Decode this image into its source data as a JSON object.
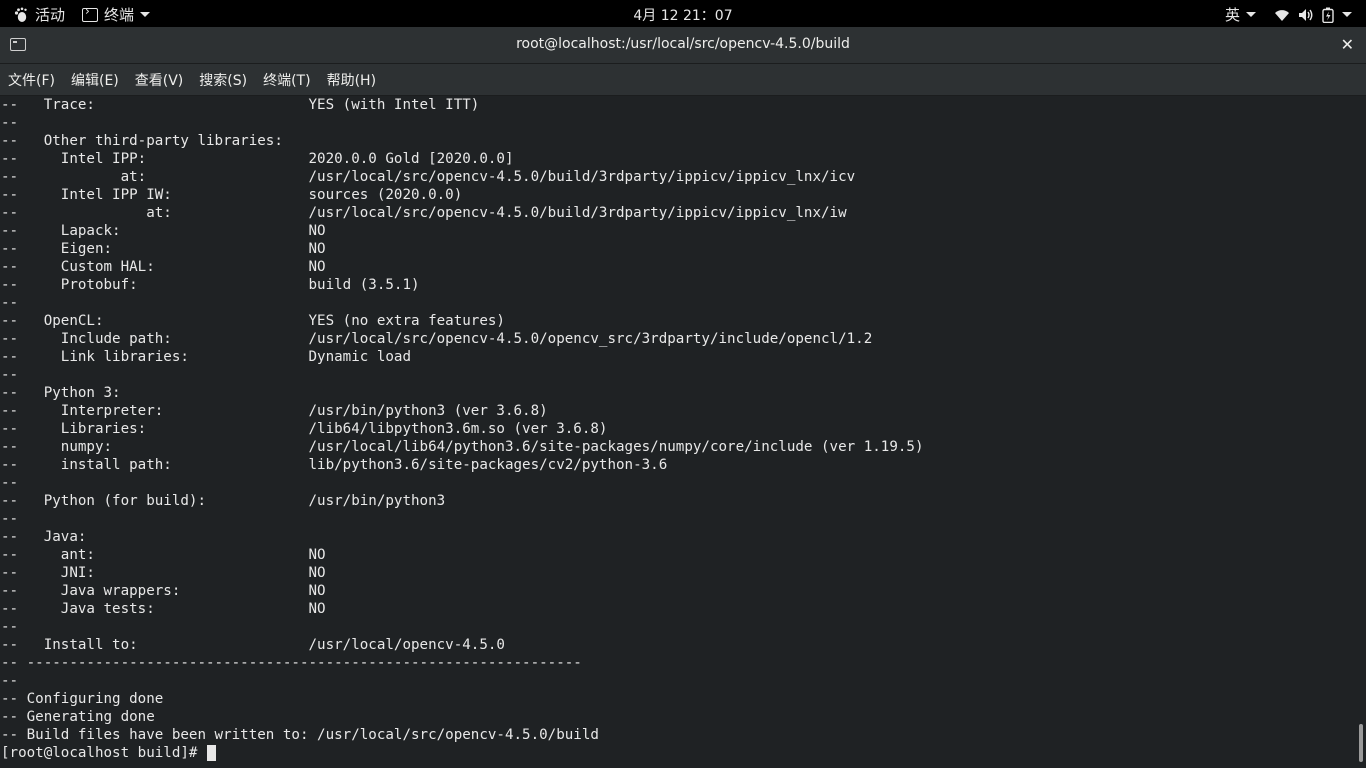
{
  "topbar": {
    "activities_label": "活动",
    "app_label": "终端",
    "clock": "4月 12 21：07",
    "input_method": "英"
  },
  "window": {
    "title": "root@localhost:/usr/local/src/opencv-4.5.0/build",
    "close_glyph": "✕"
  },
  "menu": {
    "items": [
      "文件(F)",
      "编辑(E)",
      "查看(V)",
      "搜索(S)",
      "终端(T)",
      "帮助(H)"
    ]
  },
  "terminal": {
    "lines": [
      "--   Trace:                         YES (with Intel ITT)",
      "--",
      "--   Other third-party libraries:",
      "--     Intel IPP:                   2020.0.0 Gold [2020.0.0]",
      "--            at:                   /usr/local/src/opencv-4.5.0/build/3rdparty/ippicv/ippicv_lnx/icv",
      "--     Intel IPP IW:                sources (2020.0.0)",
      "--               at:                /usr/local/src/opencv-4.5.0/build/3rdparty/ippicv/ippicv_lnx/iw",
      "--     Lapack:                      NO",
      "--     Eigen:                       NO",
      "--     Custom HAL:                  NO",
      "--     Protobuf:                    build (3.5.1)",
      "--",
      "--   OpenCL:                        YES (no extra features)",
      "--     Include path:                /usr/local/src/opencv-4.5.0/opencv_src/3rdparty/include/opencl/1.2",
      "--     Link libraries:              Dynamic load",
      "--",
      "--   Python 3:",
      "--     Interpreter:                 /usr/bin/python3 (ver 3.6.8)",
      "--     Libraries:                   /lib64/libpython3.6m.so (ver 3.6.8)",
      "--     numpy:                       /usr/local/lib64/python3.6/site-packages/numpy/core/include (ver 1.19.5)",
      "--     install path:                lib/python3.6/site-packages/cv2/python-3.6",
      "--",
      "--   Python (for build):            /usr/bin/python3",
      "--",
      "--   Java:",
      "--     ant:                         NO",
      "--     JNI:                         NO",
      "--     Java wrappers:               NO",
      "--     Java tests:                  NO",
      "--",
      "--   Install to:                    /usr/local/opencv-4.5.0",
      "-- -----------------------------------------------------------------",
      "--",
      "-- Configuring done",
      "-- Generating done",
      "-- Build files have been written to: /usr/local/src/opencv-4.5.0/build"
    ],
    "prompt": "[root@localhost build]# "
  },
  "colors": {
    "terminal_bg": "#1f2224",
    "terminal_fg": "#e8e8e8",
    "topbar_bg": "#000000",
    "headerbar_bg": "#2d3133"
  }
}
